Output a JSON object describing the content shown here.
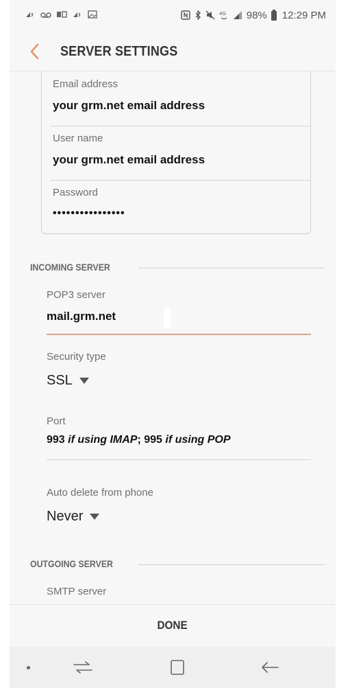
{
  "status_bar": {
    "icons_left": [
      "signal-wave-icon",
      "voicemail-icon",
      "sim-icon",
      "signal-wave-icon",
      "image-icon"
    ],
    "icons_right": [
      "nfc-icon",
      "bluetooth-icon",
      "mute-icon",
      "wifi-icon",
      "signal-icon"
    ],
    "battery": "98%",
    "time": "12:29 PM"
  },
  "header": {
    "title": "SERVER SETTINGS",
    "back_icon": "chevron-left-icon",
    "accent_color": "#e88a58"
  },
  "account": {
    "email_label": "Email address",
    "email_value": "your grm.net email address",
    "username_label": "User name",
    "username_value": "your grm.net email address",
    "password_label": "Password",
    "password_value": "••••••••••••••••"
  },
  "incoming": {
    "section_title": "INCOMING SERVER",
    "pop3_label": "POP3 server",
    "pop3_value": "mail.grm.net",
    "security_label": "Security type",
    "security_value": "SSL",
    "port_label": "Port",
    "port_value_a": "993 ",
    "port_value_b": "if using IMAP",
    "port_value_c": "; 995 ",
    "port_value_d": "if using POP",
    "auto_delete_label": "Auto delete from phone",
    "auto_delete_value": "Never"
  },
  "outgoing": {
    "section_title": "OUTGOING SERVER",
    "smtp_label": "SMTP server"
  },
  "footer": {
    "done_label": "DONE"
  },
  "nav": {
    "items": [
      "dot-icon",
      "recent-apps-icon",
      "home-icon",
      "back-arrow-icon"
    ]
  }
}
